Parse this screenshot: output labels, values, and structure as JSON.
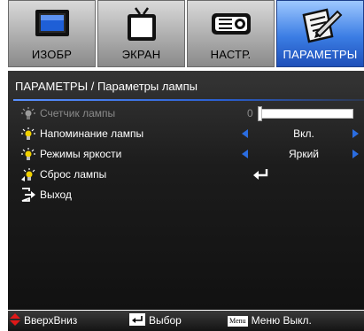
{
  "tabs": [
    {
      "label": "ИЗОБР",
      "icon": "monitor-icon",
      "active": false
    },
    {
      "label": "ЭКРАН",
      "icon": "tv-screen-icon",
      "active": false
    },
    {
      "label": "НАСТР.",
      "icon": "projector-icon",
      "active": false
    },
    {
      "label": "ПАРАМЕТРЫ",
      "icon": "options-pen-icon",
      "active": true
    }
  ],
  "panel": {
    "breadcrumb": "ПАРАМЕТРЫ / Параметры лампы",
    "items": [
      {
        "label": "Счетчик лампы",
        "value": "0",
        "enabled": false,
        "control": "slider",
        "icon": "lamp-icon"
      },
      {
        "label": "Напоминание лампы",
        "value": "Вкл.",
        "enabled": true,
        "control": "select",
        "icon": "lamp-icon"
      },
      {
        "label": "Режимы яркости",
        "value": "Яркий",
        "enabled": true,
        "control": "select",
        "icon": "lamp-icon"
      },
      {
        "label": "Сброс лампы",
        "value": "",
        "enabled": true,
        "control": "enter",
        "icon": "lamp-reset-icon"
      },
      {
        "label": "Выход",
        "value": "",
        "enabled": true,
        "control": "none",
        "icon": "exit-icon"
      }
    ]
  },
  "footer": {
    "nav_label": "ВверхВниз",
    "select_label": "Выбор",
    "menu_key": "Menu",
    "menu_label": "Меню Выкл."
  },
  "colors": {
    "accent": "#2b6de0",
    "active_tab": "#3b7de4",
    "disabled_text": "#8a8a8a",
    "nav_icon": "#e01818"
  }
}
